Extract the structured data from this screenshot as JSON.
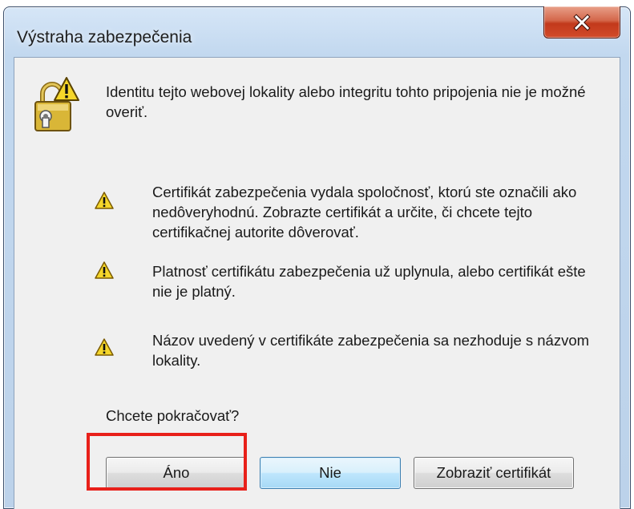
{
  "window": {
    "title": "Výstraha zabezpečenia"
  },
  "dialog": {
    "main_icon": "shield-lock-warning-icon",
    "main_message": "Identitu tejto webovej lokality alebo integritu tohto pripojenia nie je možné overiť.",
    "warnings": [
      {
        "icon": "warning-icon",
        "text": "Certifikát zabezpečenia vydala spoločnosť, ktorú ste označili ako nedôveryhodnú. Zobrazte certifikát a určite, či chcete tejto certifikačnej autorite dôverovať."
      },
      {
        "icon": "warning-icon",
        "text": "Platnosť certifikátu zabezpečenia už uplynula, alebo certifikát ešte nie je platný."
      },
      {
        "icon": "warning-icon",
        "text": "Názov uvedený v certifikáte zabezpečenia sa nezhoduje s názvom lokality."
      }
    ],
    "question": "Chcete pokračovať?",
    "buttons": {
      "yes": "Áno",
      "no": "Nie",
      "view_certificate": "Zobraziť certifikát"
    }
  },
  "colors": {
    "highlight": "#e8201a",
    "warning_fill": "#f5d62a",
    "close_button": "#c2391b"
  }
}
